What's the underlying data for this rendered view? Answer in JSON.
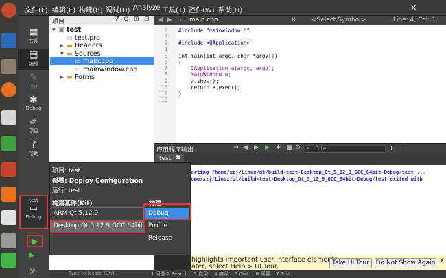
{
  "menubar": {
    "items": [
      "文件(F)",
      "编辑(E)",
      "构建(B)",
      "调试(D)",
      "Analyze",
      "工具(T)",
      "控件(W)",
      "帮助(H)"
    ]
  },
  "modes": [
    {
      "label": "欢迎",
      "icon": "grid-icon",
      "glyph": "▦",
      "state": "normal"
    },
    {
      "label": "编辑",
      "icon": "edit-icon",
      "glyph": "▤",
      "state": "active"
    },
    {
      "label": "设计",
      "icon": "pencil-icon",
      "glyph": "✎",
      "state": "disabled"
    },
    {
      "label": "Debug",
      "icon": "bug-icon",
      "glyph": "✱",
      "state": "normal"
    },
    {
      "label": "项目",
      "icon": "wrench-icon",
      "glyph": "✐",
      "state": "normal"
    },
    {
      "label": "帮助",
      "icon": "help-icon",
      "glyph": "?",
      "state": "normal"
    }
  ],
  "project": {
    "header": "项目",
    "tree": [
      {
        "label": "test",
        "depth": 0,
        "bold": true,
        "arrow": "▾",
        "icon": "▣"
      },
      {
        "label": "test.pro",
        "depth": 1,
        "arrow": "",
        "icon": "▭"
      },
      {
        "label": "Headers",
        "depth": 1,
        "arrow": "▸",
        "icon": "▬"
      },
      {
        "label": "Sources",
        "depth": 1,
        "arrow": "▾",
        "icon": "▬"
      },
      {
        "label": "main.cpp",
        "depth": 2,
        "arrow": "",
        "icon": "▭",
        "selected": true
      },
      {
        "label": "mainwindow.cpp",
        "depth": 2,
        "arrow": "",
        "icon": "▭"
      },
      {
        "label": "Forms",
        "depth": 1,
        "arrow": "▸",
        "icon": "▬"
      }
    ]
  },
  "editor": {
    "file": "main.cpp",
    "symbol": "<Select Symbol>",
    "position": "Line: 4, Col: 1",
    "lines": [
      "#include \"mainwindow.h\"",
      "",
      "#include <QApplication>",
      "",
      "int main(int argc, char *argv[])",
      "{",
      "    QApplication a(argc, argv);",
      "    MainWindow w;",
      "    w.show();",
      "    return a.exec();",
      "}",
      ""
    ],
    "line_numbers": [
      "1",
      "2",
      "3",
      "4",
      "5",
      "6",
      "7",
      "8",
      "9",
      "10",
      "11",
      "12"
    ]
  },
  "output": {
    "title": "应用程序输出",
    "filter_placeholder": "Filter",
    "tab": "test",
    "lines": [
      "tarting /home/xzj/Linux/qt/build-test-Desktop_Qt_5_12_9_GCC_64bit-Debug/test ...",
      "home/xzj/Linux/qt/build-test-Desktop_Qt_5_12_9_GCC_64bit-Debug/test exited with"
    ]
  },
  "popup": {
    "project_line": "项目: test",
    "deploy_line": "部署: Deploy Configuration",
    "run_line": "运行: test",
    "kits_header": "构建套件(Kit)",
    "build_header": "构建",
    "kits": [
      "ARM Qt 5.12.9",
      "Desktop Qt 5.12.9 GCC 64bit"
    ],
    "builds": [
      "Debug",
      "Profile",
      "Release"
    ],
    "selected_kit": "Desktop Qt 5.12.9 GCC 64bit",
    "selected_build": "Debug"
  },
  "target": {
    "name": "test",
    "mode": "Debug"
  },
  "tour": {
    "line1": "highlights important user interface elements",
    "line2": "ater, select Help > UI Tour.",
    "take_btn": "Take UI Tour",
    "dont_btn": "Do Not Show Again"
  },
  "status": {
    "search_placeholder": "Type to locate (Ctrl...",
    "tabs": "1 问题  2 Search...  3 应用...  4 编译...  5 QML...  6 概要...  7 Test..."
  },
  "colors": {
    "accent": "#3d8ee8",
    "highlight": "#e33333",
    "run": "#58c043"
  }
}
